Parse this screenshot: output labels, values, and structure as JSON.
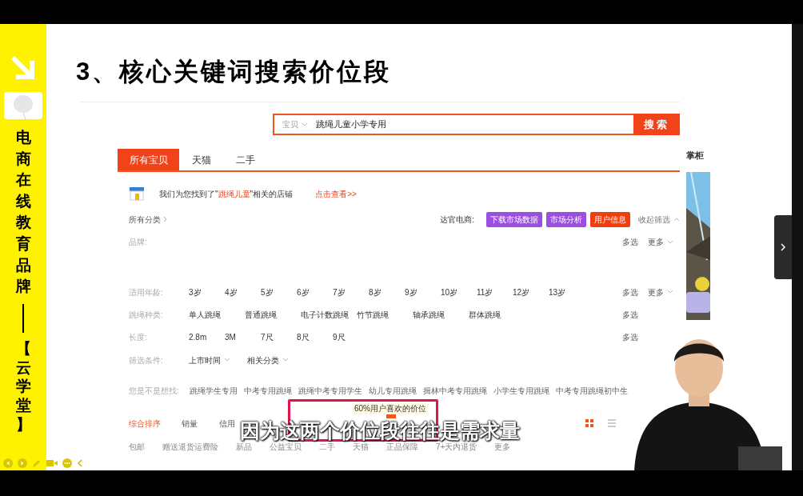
{
  "sidebar": {
    "brand": "电商在线教育品牌",
    "tag": "【云学堂】"
  },
  "slide_title": "3、核心关键词搜索价位段",
  "search": {
    "scope": "宝贝",
    "value": "跳绳儿童小学专用",
    "button": "搜索"
  },
  "tabs": [
    {
      "label": "所有宝贝",
      "selected": true
    },
    {
      "label": "天猫",
      "selected": false
    },
    {
      "label": "二手",
      "selected": false
    }
  ],
  "side_panel": {
    "title": "掌柜"
  },
  "shop_notice": {
    "before": "我们为您找到了\"",
    "keyword": "跳绳儿童",
    "after": "\"相关的店铺",
    "link": "点击查看>>"
  },
  "category": {
    "label": "所有分类",
    "tool_label": "达官电商:",
    "collapse": "收起筛选"
  },
  "tool_buttons": [
    {
      "label": "下载市场数据",
      "color": "#9b4fe0"
    },
    {
      "label": "市场分析",
      "color": "#9b4fe0"
    },
    {
      "label": "用户信息",
      "color": "#f23d0e"
    }
  ],
  "filters": [
    {
      "kind": "tall",
      "label": "品牌:",
      "multi": "多选",
      "more": "更多"
    },
    {
      "kind": "narrow",
      "label": "适用年龄:",
      "options": [
        "3岁",
        "4岁",
        "5岁",
        "6岁",
        "7岁",
        "8岁",
        "9岁",
        "10岁",
        "11岁",
        "12岁",
        "13岁"
      ],
      "multi": "多选",
      "more": "更多"
    },
    {
      "kind": "wide",
      "label": "跳绳种类:",
      "options": [
        "单人跳绳",
        "普通跳绳",
        "电子计数跳绳",
        "竹节跳绳",
        "轴承跳绳",
        "群体跳绳"
      ],
      "multi": "多选"
    },
    {
      "kind": "narrow",
      "label": "长度:",
      "options": [
        "2.8m",
        "3M",
        "7尺",
        "8尺",
        "9尺"
      ],
      "multi": "多选"
    }
  ],
  "conditions": {
    "label": "筛选条件:",
    "dropdowns": [
      "上市时间",
      "相关分类"
    ]
  },
  "suggestions": {
    "label": "您是不是想找:",
    "items": [
      "跳绳学生专用",
      "中考专用跳绳",
      "跳绳中考专用学生",
      "幼儿专用跳绳",
      "揖林中考专用跳绳",
      "小学生专用跳绳",
      "中考专用跳绳初中生"
    ]
  },
  "sort": [
    {
      "label": "综合排序",
      "selected": true
    },
    {
      "label": "销量",
      "selected": false
    },
    {
      "label": "信用",
      "selected": false
    }
  ],
  "price_tooltip": "60%用户喜欢的价位",
  "quick_filters": [
    "包邮",
    "赠送退货运费险",
    "新品",
    "公益宝贝",
    "二手",
    "天猫",
    "正品保障",
    "7+天内退货",
    "更多"
  ],
  "subtitle": "因为这两个价位段往往是需求量"
}
